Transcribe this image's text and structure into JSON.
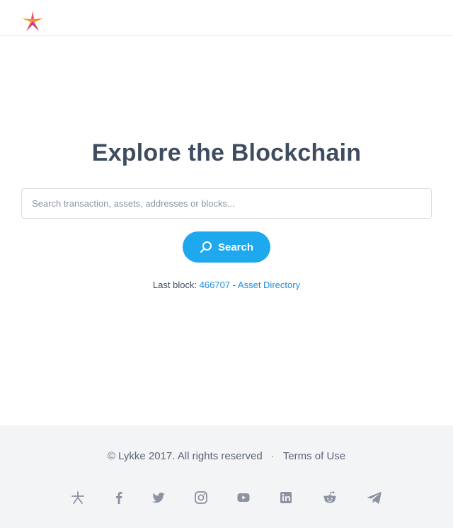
{
  "header": {
    "logo_icon": "lykke-star-logo-icon"
  },
  "main": {
    "title": "Explore the Blockchain",
    "search": {
      "placeholder": "Search transaction, assets, addresses or blocks...",
      "value": ""
    },
    "search_button": {
      "label": "Search",
      "icon": "search-icon"
    },
    "last_block": {
      "label": "Last block: ",
      "number": "466707",
      "separator": " - ",
      "asset_directory": "Asset Directory"
    }
  },
  "footer": {
    "copyright": "© Lykke 2017. All rights reserved",
    "separator": "·",
    "terms": "Terms of Use",
    "social_icons": [
      "lykke-icon",
      "facebook-icon",
      "twitter-icon",
      "instagram-icon",
      "youtube-icon",
      "linkedin-icon",
      "reddit-icon",
      "telegram-icon"
    ]
  },
  "colors": {
    "accent": "#1ea8ee",
    "link": "#1e8fe0",
    "text": "#3f4d60",
    "footer_bg": "#f3f4f6",
    "icon_gray": "#8b93a0"
  }
}
